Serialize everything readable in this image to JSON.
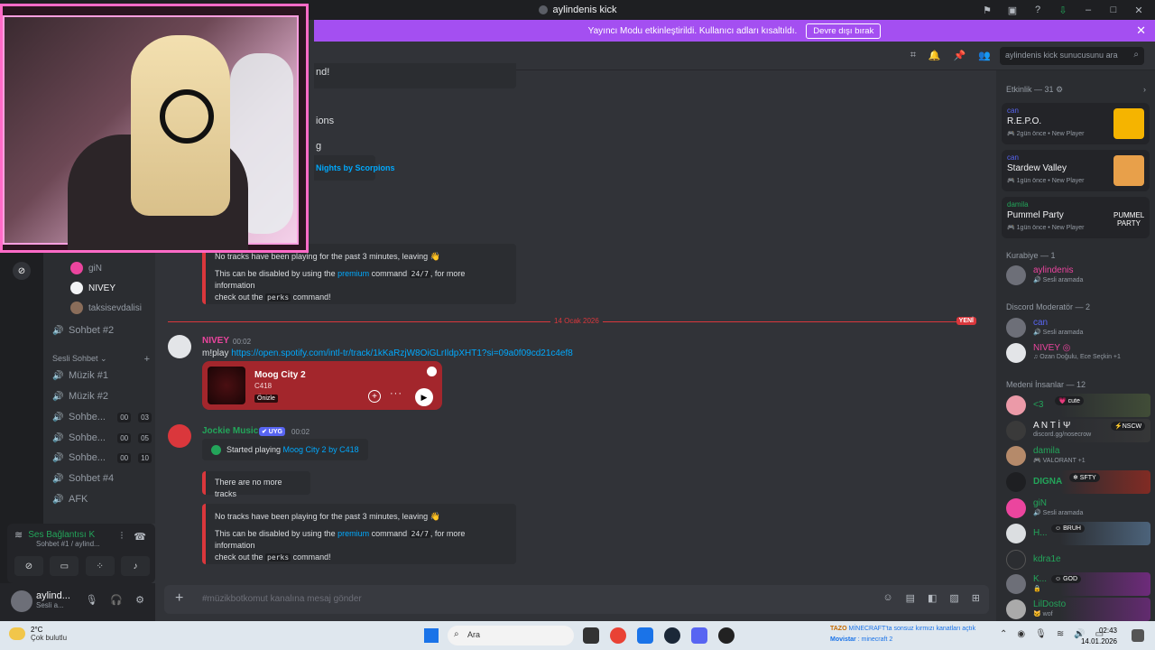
{
  "window": {
    "title": "aylindenis kick"
  },
  "banner": {
    "text": "Yayıncı Modu etkinleştirildi. Kullanıcı adları kısaltıldı.",
    "button": "Devre dışı bırak"
  },
  "channels": {
    "voice_users": [
      "giN",
      "NIVEY",
      "taksisevdalisi"
    ],
    "chat_channel": "Sohbet #2",
    "category": "Sesli Sohbet",
    "voice_channels": [
      {
        "name": "Müzik #1",
        "count": ""
      },
      {
        "name": "Müzik #2",
        "count": ""
      },
      {
        "name": "Sohbe...",
        "count": "00",
        "limit": "03"
      },
      {
        "name": "Sohbe...",
        "count": "00",
        "limit": "05"
      },
      {
        "name": "Sohbe...",
        "count": "00",
        "limit": "10"
      },
      {
        "name": "Sohbet #4",
        "count": ""
      },
      {
        "name": "AFK",
        "count": ""
      }
    ]
  },
  "voice_panel": {
    "status": "Ses Bağlantısı K",
    "channel": "Sohbet #1 / aylind..."
  },
  "user_panel": {
    "name": "aylind...",
    "status": "Sesli a..."
  },
  "header": {
    "search_placeholder": "aylindenis kick sunucusunu ara"
  },
  "messages": {
    "partial_1": "nd!",
    "partial_2": "ions",
    "partial_3": "g",
    "old_now_playing": "Nights by Scorpions",
    "embed_1": {
      "line1": "No tracks have been playing for the past 3 minutes, leaving 👋",
      "line2_pre": "This can be disabled by using the ",
      "line2_link": "premium",
      "line2_mid": " command ",
      "line2_code": "24/7",
      "line2_post": ", for more information",
      "line3_pre": "check out the ",
      "line3_code": "perks",
      "line3_post": " command!"
    },
    "divider_date": "14 Ocak 2026",
    "divider_new": "YENİ",
    "msg1": {
      "author": "NIVEY",
      "time": "00:02",
      "prefix": "m!play ",
      "url": "https://open.spotify.com/intl-tr/track/1kKaRzjW8OiGLrIldpXHT1?si=09a0f09cd21c4ef8"
    },
    "spotify": {
      "track": "Moog City 2",
      "artist": "C418",
      "preview": "Önizle"
    },
    "msg2": {
      "author": "Jockie Music",
      "tag": "✔ UYG",
      "time": "00:02",
      "started_pre": "Started playing ",
      "started_link": "Moog City 2 by C418",
      "no_more": "There are no more tracks"
    },
    "embed_2": {
      "line1": "No tracks have been playing for the past 3 minutes, leaving 👋",
      "line2_pre": "This can be disabled by using the ",
      "line2_link": "premium",
      "line2_mid": " command ",
      "line2_code": "24/7",
      "line2_post": ", for more information",
      "line3_pre": "check out the ",
      "line3_code": "perks",
      "line3_post": " command!"
    }
  },
  "composer": {
    "placeholder": "#müzikbotkomut kanalına mesaj gönder"
  },
  "members": {
    "activity_header": "Etkinlik — 31 ⚙",
    "activities": [
      {
        "user": "can",
        "game": "R.E.P.O.",
        "meta": "🎮 2gün önce  •  New Player",
        "color": "#f5b400"
      },
      {
        "user": "can",
        "game": "Stardew Valley",
        "meta": "🎮 1gün önce  •  New Player",
        "color": "#e8a04a"
      },
      {
        "user": "damila",
        "game": "Pummel Party",
        "meta": "🎮 1gün önce  •  New Player",
        "color": "#232428",
        "logo": "PUMMEL PARTY"
      }
    ],
    "groups": [
      {
        "title": "Kurabiye — 1",
        "members": [
          {
            "name": "aylindenis",
            "status": "🔊 Sesli aramada",
            "color": "#eb459e"
          }
        ]
      },
      {
        "title": "Discord Moderatör — 2",
        "members": [
          {
            "name": "can",
            "status": "🔊 Sesli aramada",
            "color": "#5865f2"
          },
          {
            "name": "NIVEY ◎",
            "status": "♫ Ozan Doğulu, Ece Seçkin +1",
            "color": "#eb459e"
          }
        ]
      },
      {
        "title": "Medeni İnsanlar — 12",
        "members": [
          {
            "name": "<3",
            "tag": "💗 cute",
            "status": "",
            "color": "#23a55a"
          },
          {
            "name": "A N T İ Ψ",
            "tag": "⚡NSCW",
            "status": "discord.gg/nosecrow",
            "color": "#f2f3f5"
          },
          {
            "name": "damila",
            "status": "🎮 VALORANT +1",
            "color": "#23a55a"
          },
          {
            "name": "DIGNA",
            "tag": "❄ SFTY",
            "status": "",
            "color": "#23a55a"
          },
          {
            "name": "giN",
            "status": "🔊 Sesli aramada",
            "color": "#23a55a"
          },
          {
            "name": "H...",
            "tag": "☺ BRUH",
            "status": "",
            "color": "#23a55a"
          },
          {
            "name": "kdra1e",
            "status": "",
            "color": "#23a55a"
          },
          {
            "name": "K...",
            "tag": "☺ GOD",
            "status": "🔒",
            "color": "#23a55a"
          },
          {
            "name": "LilDosto",
            "status": "🐱 wof",
            "color": "#23a55a"
          }
        ]
      }
    ]
  },
  "taskbar": {
    "temp": "2°C",
    "weather": "Çok bulutlu",
    "search": "Ara",
    "ticker_1": "TAZO",
    "ticker_1b": " MİNECRAFT'ta sonsuz kırmızı kanatları açtık",
    "ticker_2": "Movistar",
    "ticker_2b": " : minecraft 2",
    "time": "02:43",
    "date": "14.01.2026"
  }
}
